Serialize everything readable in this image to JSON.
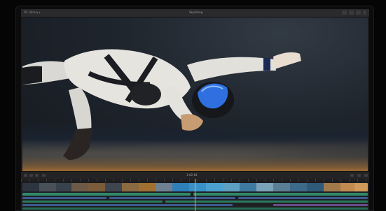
{
  "toolbar": {
    "library_label": "Fill Library ▸",
    "viewer_title": "Skydiving"
  },
  "transport": {
    "timecode": "1:02:18"
  },
  "colors": {
    "video_clip": "#3b5a8c",
    "audio_clip": "#2e8a6a",
    "title_clip": "#6a4a8a",
    "playhead": "#d8c44a"
  }
}
